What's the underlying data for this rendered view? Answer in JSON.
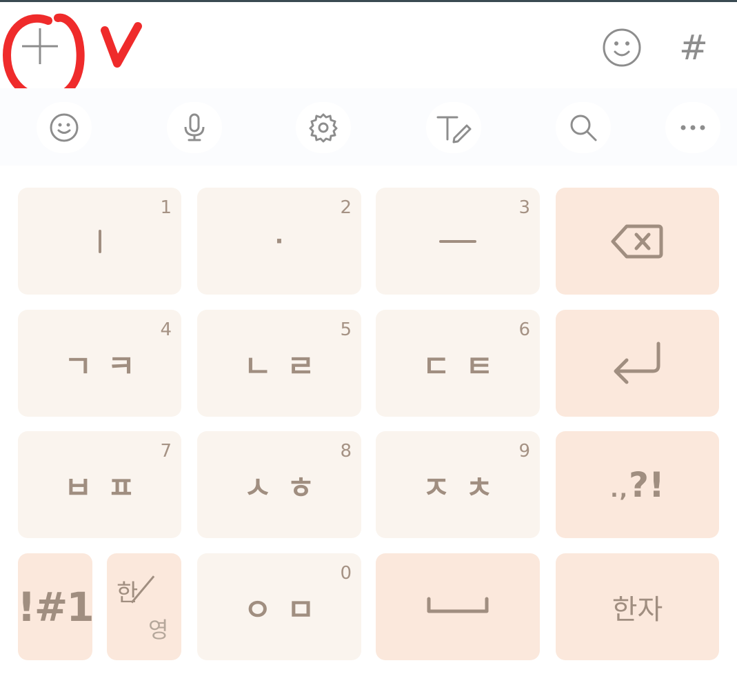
{
  "colors": {
    "key_bg": "#faf4ee",
    "func_key_bg": "#fbe8dc",
    "key_text": "#a08e80",
    "icon_gray": "#8d8d8d",
    "annotation_red": "#ef2b2b"
  },
  "input_row": {
    "hash_label": "#"
  },
  "toolbar": {
    "items": [
      "emoji-icon",
      "microphone-icon",
      "settings-gear-icon",
      "text-edit-icon",
      "search-icon",
      "more-icon"
    ]
  },
  "keys": {
    "row1": [
      {
        "num": "1",
        "main": "ㅣ"
      },
      {
        "num": "2",
        "main": "·"
      },
      {
        "num": "3",
        "main": "ㅡ"
      }
    ],
    "row2": [
      {
        "num": "4",
        "main": "ㄱㅋ"
      },
      {
        "num": "5",
        "main": "ㄴㄹ"
      },
      {
        "num": "6",
        "main": "ㄷㅌ"
      }
    ],
    "row3": [
      {
        "num": "7",
        "main": "ㅂㅍ"
      },
      {
        "num": "8",
        "main": "ㅅㅎ"
      },
      {
        "num": "9",
        "main": "ㅈㅊ"
      }
    ],
    "row4": {
      "symbols": "!#1",
      "han": "한",
      "yeong": "영",
      "zero_num": "0",
      "zero_main": "ㅇㅁ",
      "hanja": "한자"
    },
    "punct_main": "?!",
    "punct_small": ".,"
  }
}
